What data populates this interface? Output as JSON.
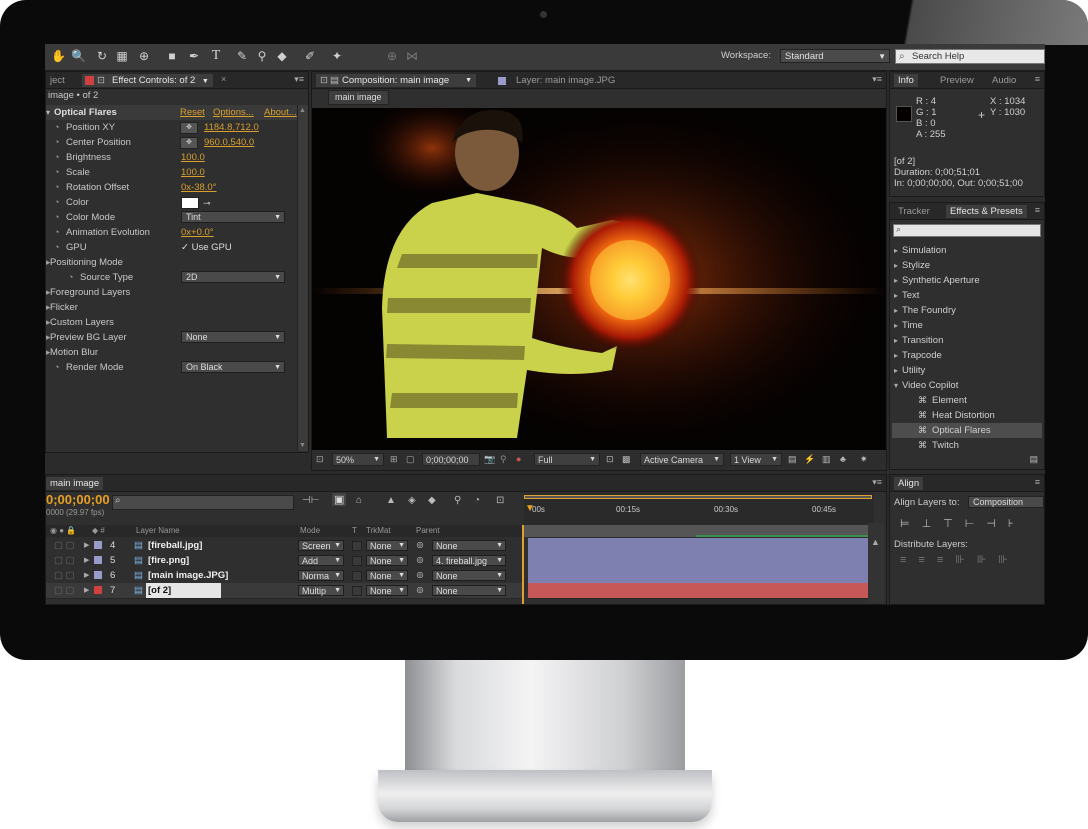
{
  "toolbar": {
    "workspace_label": "Workspace:",
    "workspace_value": "Standard",
    "search_placeholder": "Search Help"
  },
  "effect_controls": {
    "tabs": [
      "ject",
      "Effect Controls: of 2"
    ],
    "layer_title": "image • of 2",
    "effect_name": "Optical Flares",
    "reset_label": "Reset",
    "options_label": "Options...",
    "about_label": "About...",
    "props": [
      {
        "label": "Position XY",
        "value": "1184.8,712.0",
        "kind": "value-target"
      },
      {
        "label": "Center Position",
        "value": "960.0,540.0",
        "kind": "value-target"
      },
      {
        "label": "Brightness",
        "value": "100.0",
        "kind": "value"
      },
      {
        "label": "Scale",
        "value": "100.0",
        "kind": "value"
      },
      {
        "label": "Rotation Offset",
        "value": "0x-38.0°",
        "kind": "value"
      },
      {
        "label": "Color",
        "value": "",
        "kind": "color"
      },
      {
        "label": "Color Mode",
        "value": "Tint",
        "kind": "dropdown"
      },
      {
        "label": "Animation Evolution",
        "value": "0x+0.0°",
        "kind": "value"
      },
      {
        "label": "GPU",
        "value": "Use GPU",
        "kind": "checkbox"
      },
      {
        "label": "Positioning Mode",
        "value": "",
        "kind": "group"
      },
      {
        "label": "Source Type",
        "value": "2D",
        "kind": "dropdown-sub"
      },
      {
        "label": "Foreground Layers",
        "value": "",
        "kind": "group"
      },
      {
        "label": "Flicker",
        "value": "",
        "kind": "group"
      },
      {
        "label": "Custom Layers",
        "value": "",
        "kind": "group"
      },
      {
        "label": "Preview BG Layer",
        "value": "None",
        "kind": "dropdown-group"
      },
      {
        "label": "Motion Blur",
        "value": "",
        "kind": "group"
      },
      {
        "label": "Render Mode",
        "value": "On Black",
        "kind": "dropdown"
      }
    ]
  },
  "composition": {
    "tab_label": "Composition: main image",
    "layer_tab_label": "Layer: main image.JPG",
    "breadcrumb": "main image",
    "zoom": "50%",
    "timecode": "0;00;00;00",
    "resolution": "Full",
    "camera": "Active Camera",
    "views": "1 View"
  },
  "info": {
    "tabs": [
      "Info",
      "Preview",
      "Audio"
    ],
    "r": "R : 4",
    "g": "G : 1",
    "b": "B : 0",
    "a": "A : 255",
    "x": "X : 1034",
    "y": "Y : 1030",
    "line1": "[of 2]",
    "line2": "Duration: 0;00;51;01",
    "line3": "In: 0;00;00;00, Out: 0;00;51;00"
  },
  "effects_presets": {
    "tabs": [
      "Tracker",
      "Effects & Presets"
    ],
    "search_placeholder": "",
    "items": [
      {
        "label": "Simulation",
        "type": "folder"
      },
      {
        "label": "Stylize",
        "type": "folder"
      },
      {
        "label": "Synthetic Aperture",
        "type": "folder"
      },
      {
        "label": "Text",
        "type": "folder"
      },
      {
        "label": "The Foundry",
        "type": "folder"
      },
      {
        "label": "Time",
        "type": "folder"
      },
      {
        "label": "Transition",
        "type": "folder"
      },
      {
        "label": "Trapcode",
        "type": "folder"
      },
      {
        "label": "Utility",
        "type": "folder"
      },
      {
        "label": "Video Copilot",
        "type": "folder-open"
      },
      {
        "label": "Element",
        "type": "effect"
      },
      {
        "label": "Heat Distortion",
        "type": "effect"
      },
      {
        "label": "Optical Flares",
        "type": "effect-selected"
      },
      {
        "label": "Twitch",
        "type": "effect"
      }
    ]
  },
  "timeline": {
    "tab_label": "main image",
    "timecode": "0;00;00;00",
    "fps": "0000 (29.97 fps)",
    "columns": {
      "layer_name": "Layer Name",
      "mode": "Mode",
      "t": "T",
      "trkmat": "TrkMat",
      "parent": "Parent"
    },
    "ruler": [
      "00s",
      "00:15s",
      "00:30s",
      "00:45s"
    ],
    "layers": [
      {
        "num": "4",
        "name": "[fireball.jpg]",
        "mode": "Screen",
        "trkmat": "None",
        "parent": "None",
        "color": "#9a9acb",
        "bar": "#7e80b0"
      },
      {
        "num": "5",
        "name": "[fire.png]",
        "mode": "Add",
        "trkmat": "None",
        "parent": "4. fireball.jpg",
        "color": "#9a9acb",
        "bar": "#7e80b0"
      },
      {
        "num": "6",
        "name": "[main image.JPG]",
        "mode": "Norma",
        "trkmat": "None",
        "parent": "None",
        "color": "#9a9acb",
        "bar": "#7e80b0"
      },
      {
        "num": "7",
        "name": "[of 2]",
        "mode": "Multip",
        "trkmat": "None",
        "parent": "None",
        "color": "#d04040",
        "bar": "#c65858"
      }
    ]
  },
  "align": {
    "tab_label": "Align",
    "align_layers_to": "Align Layers to:",
    "align_target": "Composition",
    "distribute_label": "Distribute Layers:"
  },
  "colors": {
    "accent_orange": "#d9a030",
    "panel_bg": "#2f2f2f",
    "selection": "#4d4d4d"
  }
}
